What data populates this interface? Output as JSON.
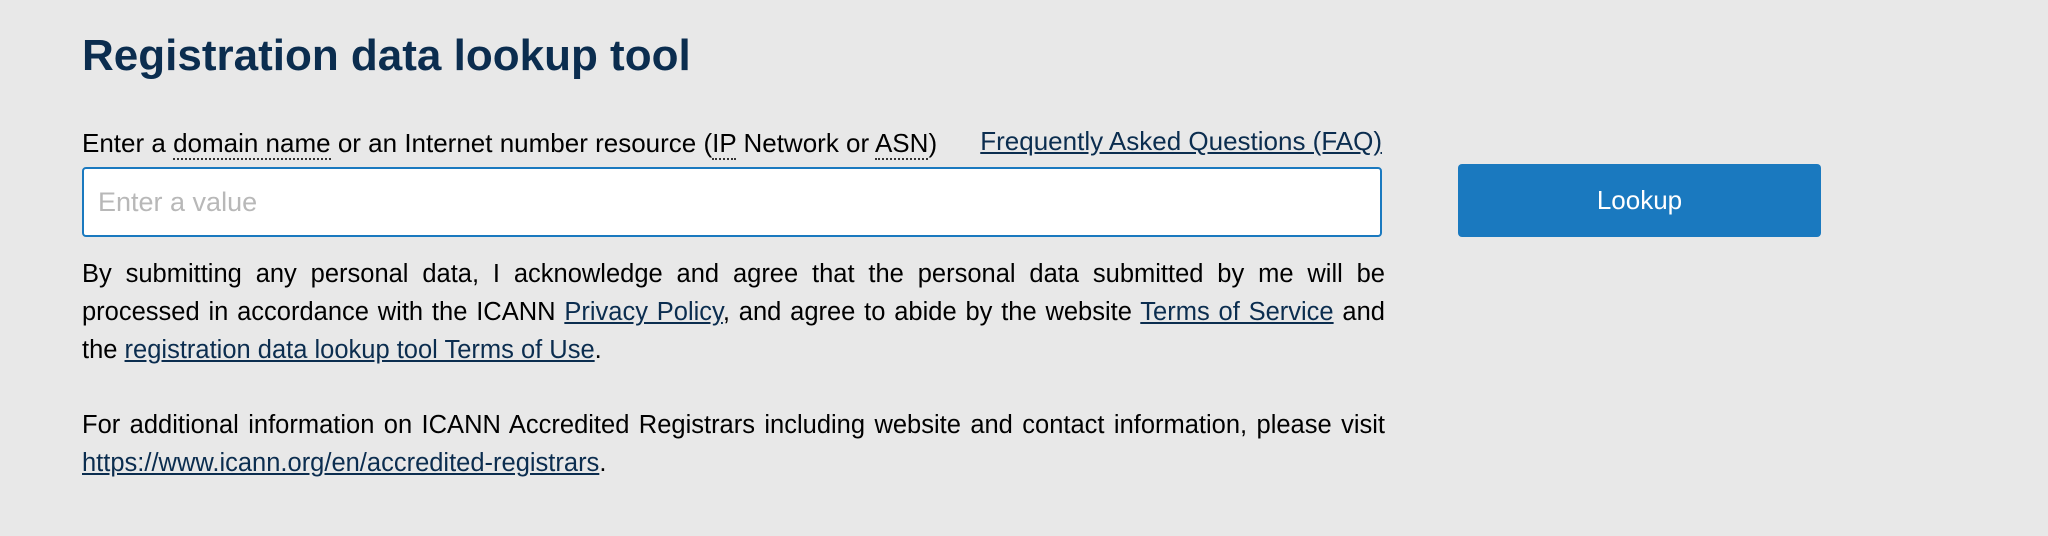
{
  "page": {
    "title": "Registration data lookup tool"
  },
  "prompt": {
    "prefix": "Enter a ",
    "domain_name": "domain name",
    "middle": " or an Internet number resource (",
    "ip": "IP",
    "network_or": " Network or ",
    "asn": "ASN",
    "suffix": ")"
  },
  "faq_link": "Frequently Asked Questions (FAQ)",
  "search": {
    "value": "",
    "placeholder": "Enter a value"
  },
  "lookup_button": "Lookup",
  "disclaimer": {
    "text1": "By submitting any personal data, I acknowledge and agree that the personal data submitted by me will be processed in accordance with the ICANN ",
    "privacy_policy": "Privacy Policy",
    "text2": ", and agree to abide by the website ",
    "terms_of_service": "Terms of Service",
    "text3": " and the ",
    "terms_of_use": "registration data lookup tool Terms of Use",
    "text4": "."
  },
  "additional_info": {
    "text1": "For additional information on ICANN Accredited Registrars including website and contact information, please visit ",
    "link": "https://www.icann.org/en/accredited-registrars",
    "text2": "."
  },
  "colors": {
    "background": "#e8e8e8",
    "title": "#0b2d4f",
    "accent": "#1a79bf",
    "link": "#0b2d4f"
  }
}
